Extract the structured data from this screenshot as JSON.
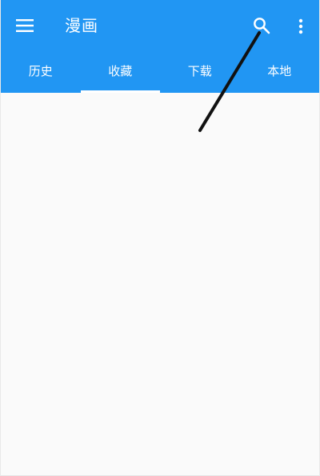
{
  "app": {
    "title": "漫画"
  },
  "toolbar": {
    "menu_icon": "hamburger-menu-icon",
    "search_icon": "search-icon",
    "more_icon": "more-vertical-icon"
  },
  "tabs": [
    {
      "label": "历史",
      "active": false
    },
    {
      "label": "收藏",
      "active": true
    },
    {
      "label": "下载",
      "active": false
    },
    {
      "label": "本地",
      "active": false
    }
  ],
  "colors": {
    "primary": "#2196f3",
    "tab_indicator": "#ffffff",
    "background": "#fafafa",
    "annotation_stroke": "#111111"
  }
}
